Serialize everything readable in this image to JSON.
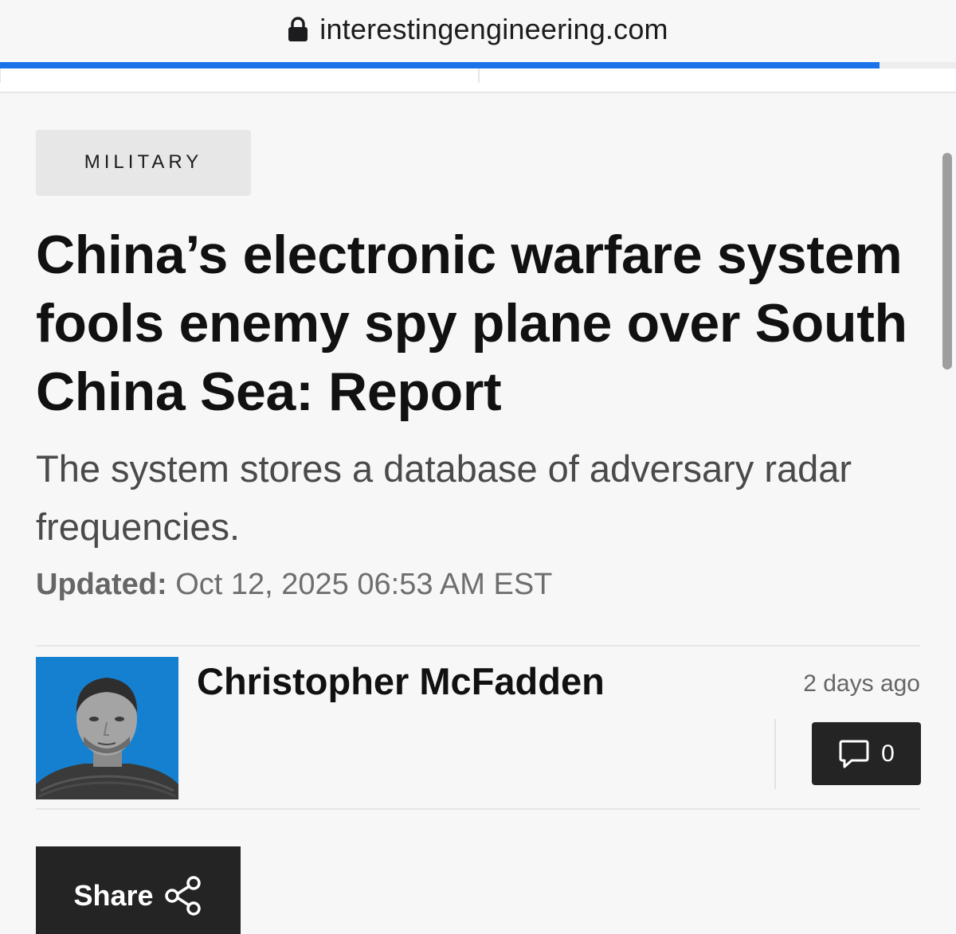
{
  "browser": {
    "url": "interestingengineering.com",
    "load_progress": 0.92
  },
  "article": {
    "category": "MILITARY",
    "headline": "China’s electronic warfare system fools enemy spy plane over South China Sea: Report",
    "subheadline": "The system stores a database of adversary radar frequencies.",
    "updated_label": "Updated:",
    "updated_value": " Oct 12, 2025 06:53 AM EST"
  },
  "byline": {
    "author": "Christopher McFadden",
    "relative_time": "2 days ago",
    "comments_count": "0"
  },
  "actions": {
    "share_label": "Share"
  },
  "colors": {
    "progress": "#1a73e8",
    "button_dark": "#242424",
    "avatar_bg": "#1580cf"
  },
  "icons": [
    "lock-icon",
    "comment-icon",
    "share-icon"
  ]
}
